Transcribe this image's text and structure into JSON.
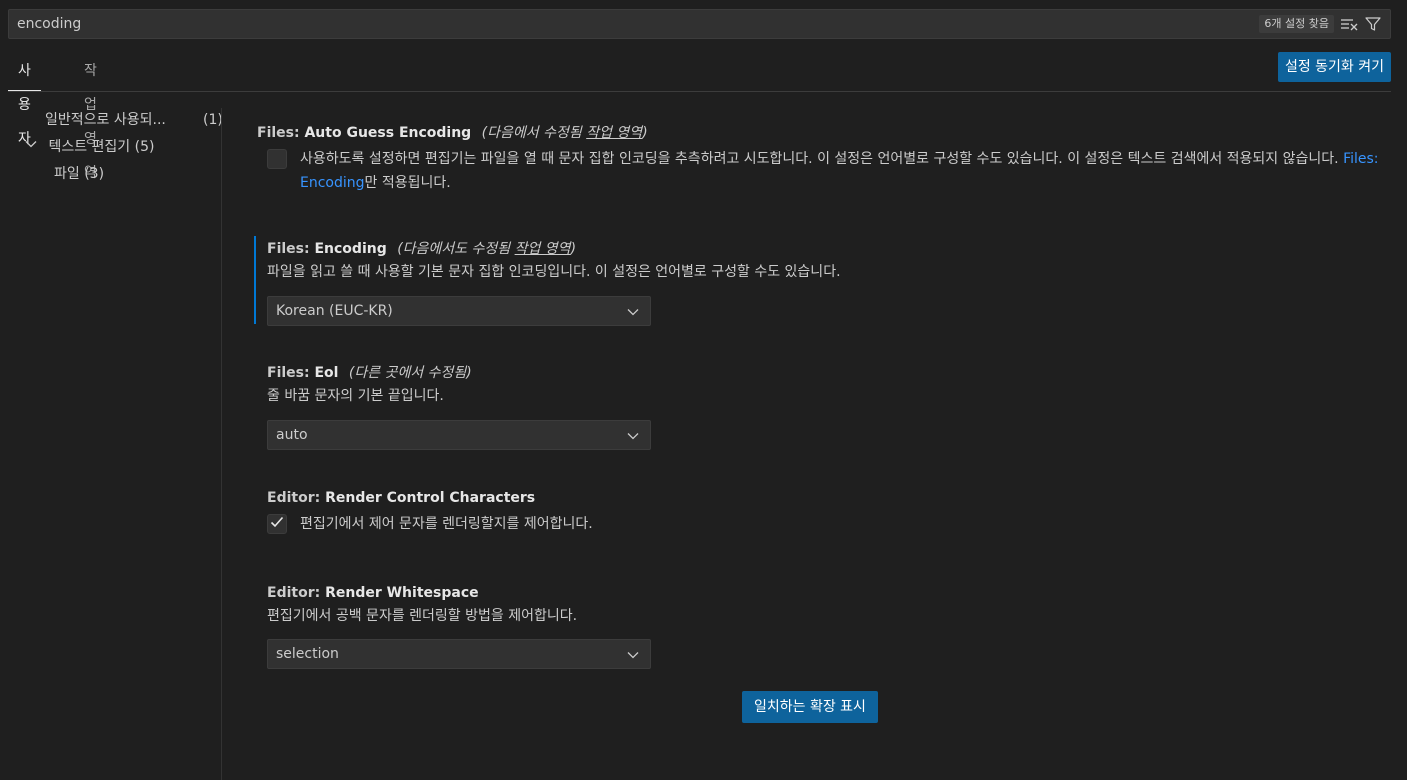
{
  "search": {
    "value": "encoding",
    "result_count": "6개 설정 찾음",
    "clear_icon": "clear-filter-icon",
    "filter_icon": "filter-icon"
  },
  "tabs": [
    {
      "label": "사용자",
      "active": true
    },
    {
      "label": "작업 영역",
      "active": false
    }
  ],
  "sync_button": "설정 동기화 켜기",
  "toc": [
    {
      "label": "일반적으로 사용되...",
      "count": "(1)"
    },
    {
      "label": "텍스트 편집기",
      "count": "(5)",
      "expanded": true
    },
    {
      "label": "파일",
      "count": "(3)"
    }
  ],
  "settings": [
    {
      "category": "Files: ",
      "name": "Auto Guess Encoding",
      "modified_prefix": "(다음에서 수정됨 ",
      "modified_link": "작업 영역",
      "modified_suffix": ")",
      "desc_before": "사용하도록 설정하면 편집기는 파일을 열 때 문자 집합 인코딩을 추측하려고 시도합니다. 이 설정은 언어별로 구성할 수도 있습니다. 이 설정은 텍스트 검색에서 적용되지 않습니다. ",
      "desc_link": "Files: Encoding",
      "desc_after": "만 적용됩니다.",
      "checked": false
    },
    {
      "category": "Files: ",
      "name": "Encoding",
      "modified_prefix": "(다음에서도 수정됨 ",
      "modified_link": "작업 영역",
      "modified_suffix": ")",
      "desc": "파일을 읽고 쓸 때 사용할 기본 문자 집합 인코딩입니다. 이 설정은 언어별로 구성할 수도 있습니다.",
      "value": "Korean (EUC-KR)"
    },
    {
      "category": "Files: ",
      "name": "Eol",
      "modified": "(다른 곳에서 수정됨)",
      "desc": "줄 바꿈 문자의 기본 끝입니다.",
      "value": "auto"
    },
    {
      "category": "Editor: ",
      "name": "Render Control Characters",
      "desc": "편집기에서 제어 문자를 렌더링할지를 제어합니다.",
      "checked": true
    },
    {
      "category": "Editor: ",
      "name": "Render Whitespace",
      "desc": "편집기에서 공백 문자를 렌더링할 방법을 제어합니다.",
      "value": "selection"
    }
  ],
  "show_extensions_button": "일치하는 확장 표시",
  "colors": {
    "background": "#1f1f1f",
    "accent_button": "#0e639c",
    "link": "#3794ff",
    "focus": "#0078d4"
  }
}
